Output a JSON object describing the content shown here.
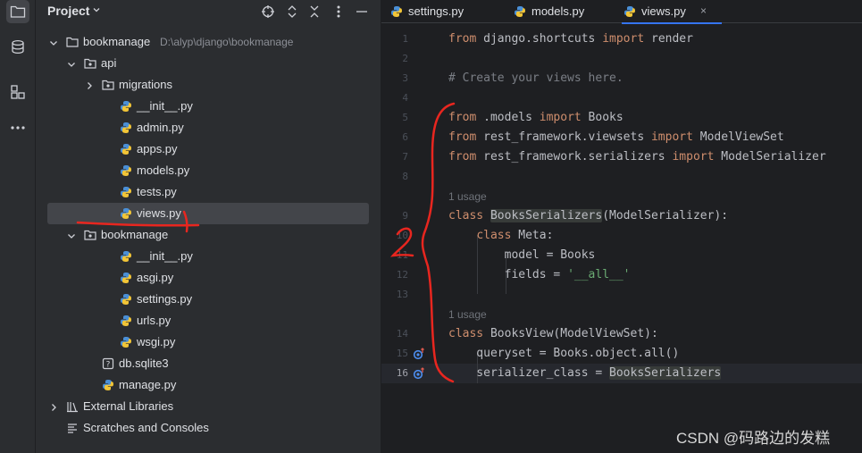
{
  "project_panel": {
    "title": "Project",
    "tree": [
      {
        "label": "bookmanage",
        "path": "D:\\alyp\\django\\bookmanage",
        "type": "folder",
        "expanded": true
      },
      {
        "label": "api",
        "type": "package",
        "expanded": true
      },
      {
        "label": "migrations",
        "type": "package",
        "expanded": false
      },
      {
        "label": "__init__.py",
        "type": "python"
      },
      {
        "label": "admin.py",
        "type": "python"
      },
      {
        "label": "apps.py",
        "type": "python"
      },
      {
        "label": "models.py",
        "type": "python"
      },
      {
        "label": "tests.py",
        "type": "python"
      },
      {
        "label": "views.py",
        "type": "python",
        "selected": true
      },
      {
        "label": "bookmanage",
        "type": "package",
        "expanded": true
      },
      {
        "label": "__init__.py",
        "type": "python"
      },
      {
        "label": "asgi.py",
        "type": "python"
      },
      {
        "label": "settings.py",
        "type": "python"
      },
      {
        "label": "urls.py",
        "type": "python"
      },
      {
        "label": "wsgi.py",
        "type": "python"
      },
      {
        "label": "db.sqlite3",
        "type": "db"
      },
      {
        "label": "manage.py",
        "type": "python"
      },
      {
        "label": "External Libraries",
        "type": "library",
        "expanded": false
      },
      {
        "label": "Scratches and Consoles",
        "type": "scratches"
      }
    ]
  },
  "tabs": [
    {
      "label": "settings.py"
    },
    {
      "label": "models.py"
    },
    {
      "label": "views.py",
      "active": true,
      "close": "×"
    }
  ],
  "editor": {
    "line_numbers": [
      "1",
      "2",
      "3",
      "4",
      "5",
      "6",
      "7",
      "8",
      "9",
      "10",
      "11",
      "12",
      "13",
      "14",
      "15",
      "16"
    ],
    "usage_hint": "1 usage",
    "code": {
      "l1": {
        "kw1": "from",
        "t1": " django.shortcuts ",
        "kw2": "import",
        "t2": " render"
      },
      "l3": {
        "cmt": "# Create your views here."
      },
      "l5": {
        "kw1": "from",
        "t1": " .models ",
        "kw2": "import",
        "t2": " Books"
      },
      "l6": {
        "kw1": "from",
        "t1": " rest_framework.viewsets ",
        "kw2": "import",
        "t2": " ModelViewSet"
      },
      "l7": {
        "kw1": "from",
        "t1": " rest_framework.serializers ",
        "kw2": "import",
        "t2": " ModelSerializer"
      },
      "l9": {
        "kw": "class",
        "sp": " ",
        "name": "BooksSerializers",
        "rest": "(ModelSerializer):"
      },
      "l10": {
        "indent": "    ",
        "kw": "class",
        "rest": " Meta:"
      },
      "l11": {
        "text": "        model = Books"
      },
      "l12": {
        "pre": "        fields = ",
        "str": "'__all__'"
      },
      "l14": {
        "kw": "class",
        "rest": " BooksView(ModelViewSet):"
      },
      "l15": {
        "text": "    queryset = Books.object.all()"
      },
      "l16": {
        "pre": "    serializer_class = ",
        "hl": "BooksSerializers"
      }
    }
  },
  "annotations": {
    "mark1": "1",
    "mark2": "2"
  },
  "watermark": "CSDN @码路边的发糕",
  "colors": {
    "accent": "#3574f0",
    "keyword": "#cf8e6d",
    "string": "#6aab73",
    "comment": "#7a7e85",
    "annotation": "#e8261f"
  }
}
